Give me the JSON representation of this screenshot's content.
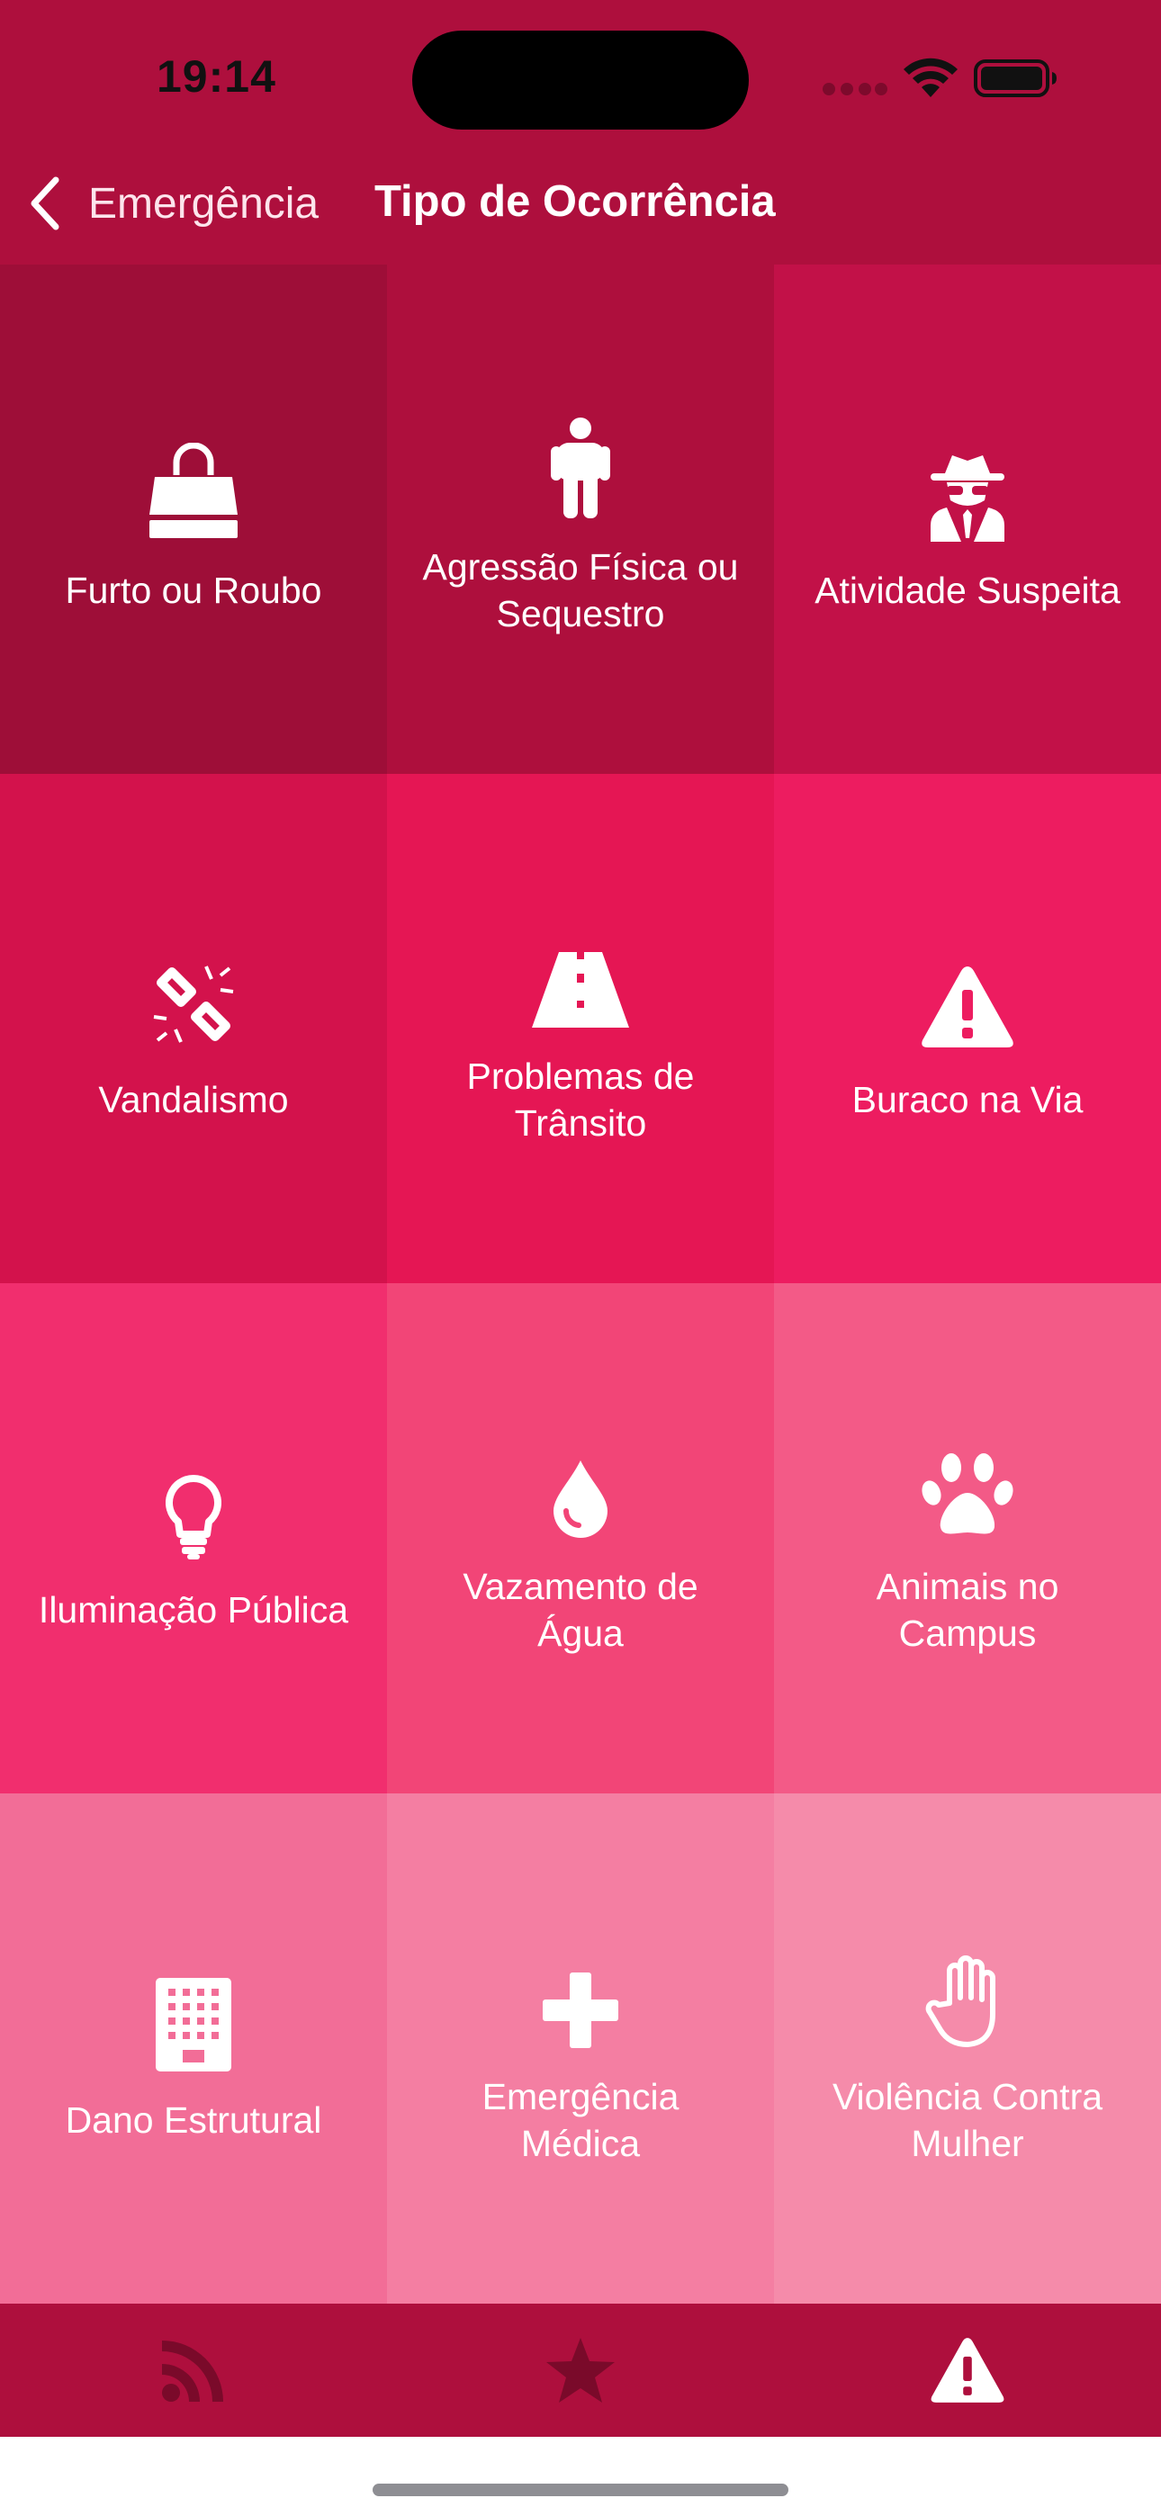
{
  "status_bar": {
    "time": "19:14"
  },
  "nav": {
    "back_label": "Emergência",
    "title": "Tipo de Ocorrência"
  },
  "grid": {
    "tiles": [
      {
        "label": "Furto ou Roubo",
        "icon": "shopping-bag-icon",
        "color": "#9e0e38"
      },
      {
        "label": "Agressão Física ou Sequestro",
        "icon": "person-icon",
        "color": "#ae0f3d"
      },
      {
        "label": "Atividade Suspeita",
        "icon": "spy-icon",
        "color": "#c21148"
      },
      {
        "label": "Vandalismo",
        "icon": "broken-link-icon",
        "color": "#d3124c"
      },
      {
        "label": "Problemas de Trânsito",
        "icon": "road-icon",
        "color": "#e51654"
      },
      {
        "label": "Buraco na Via",
        "icon": "warning-triangle-icon",
        "color": "#ed1c60"
      },
      {
        "label": "Iluminação Pública",
        "icon": "lightbulb-icon",
        "color": "#f12e6e"
      },
      {
        "label": "Vazamento de Água",
        "icon": "water-drop-icon",
        "color": "#f24577"
      },
      {
        "label": "Animais no Campus",
        "icon": "paw-icon",
        "color": "#f35a87"
      },
      {
        "label": "Dano Estrutural",
        "icon": "building-icon",
        "color": "#f26d97"
      },
      {
        "label": "Emergência Médica",
        "icon": "medical-cross-icon",
        "color": "#f47ea2"
      },
      {
        "label": "Violência Contra Mulher",
        "icon": "hand-stop-icon",
        "color": "#f58baa"
      }
    ]
  },
  "tabbar": {
    "tabs": [
      {
        "icon": "rss-feed-icon",
        "active": false
      },
      {
        "icon": "star-icon",
        "active": false
      },
      {
        "icon": "warning-triangle-icon",
        "active": true
      }
    ],
    "inactive_color": "#7a0a2a",
    "active_color": "#ffffff"
  },
  "colors": {
    "header": "#ae0f3d",
    "tabbar": "#ae0f3d"
  }
}
